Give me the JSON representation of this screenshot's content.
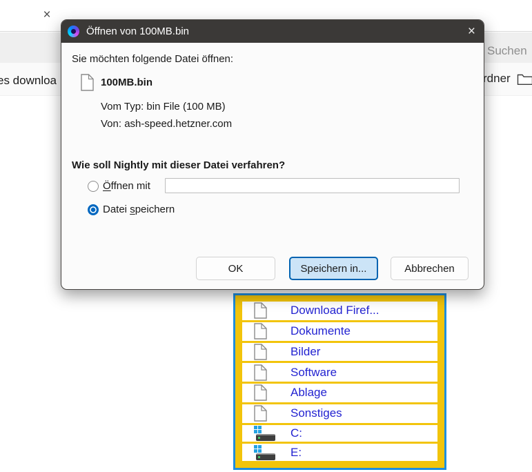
{
  "window": {
    "tab": {
      "close_icon": "×"
    },
    "explorer": {
      "search_label": "Suchen",
      "new_folder_partial_label": "rdner",
      "page_partial_text": "es downloa"
    }
  },
  "dialog": {
    "title": "Öffnen von 100MB.bin",
    "close_icon": "×",
    "intro": "Sie möchten folgende Datei öffnen:",
    "file": {
      "name": "100MB.bin",
      "type_line": "Vom Typ: bin File (100 MB)",
      "source_line": "Von: ash-speed.hetzner.com"
    },
    "question": "Wie soll Nightly mit dieser Datei verfahren?",
    "options": {
      "open_with": {
        "key": "Ö",
        "rest": "ffnen mit",
        "selected": false
      },
      "save_file": {
        "pre": "Datei ",
        "key": "s",
        "rest": "peichern",
        "selected": true
      }
    },
    "combo_value": "",
    "buttons": {
      "ok": "OK",
      "save_in": "Speichern in...",
      "cancel": "Abbrechen"
    }
  },
  "menu": {
    "items": [
      {
        "label": "Download Firef...",
        "icon": "file"
      },
      {
        "label": "Dokumente",
        "icon": "file"
      },
      {
        "label": "Bilder",
        "icon": "file"
      },
      {
        "label": "Software",
        "icon": "file"
      },
      {
        "label": "Ablage",
        "icon": "file"
      },
      {
        "label": "Sonstiges",
        "icon": "file"
      },
      {
        "label": "C:",
        "icon": "drive"
      },
      {
        "label": "E:",
        "icon": "drive"
      }
    ]
  },
  "colors": {
    "accent_blue": "#0067c0",
    "focus_button_bg": "#cce4f7",
    "titlebar": "#3b3937",
    "menu_frame_yellow": "#f2c40b",
    "menu_frame_blue": "#1e8ede",
    "menu_text_blue": "#2323d1"
  }
}
